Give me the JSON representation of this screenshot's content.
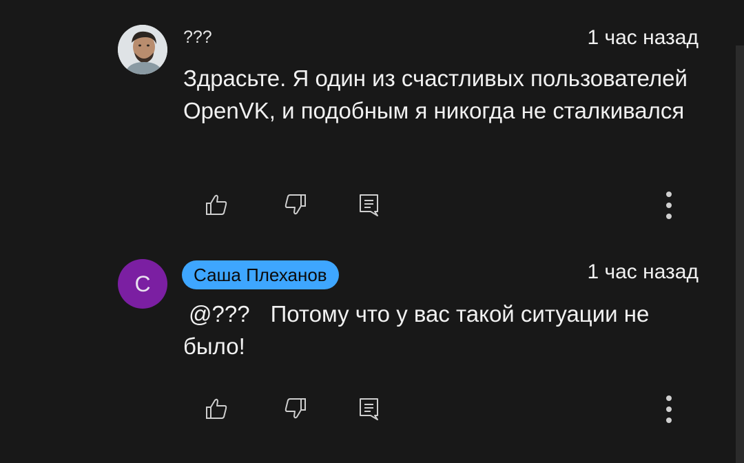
{
  "comments": [
    {
      "author": "???",
      "time": "1 час назад",
      "text": "Здрасьте. Я один из счастливых пользователей OpenVK, и подобным я никогда не сталкивался",
      "avatar_icon": "user-photo-avatar"
    },
    {
      "author": "Саша Плеханов",
      "author_chip_color": "#3ea6ff",
      "avatar_letter": "С",
      "avatar_color": "#7b1fa2",
      "time": "1 час назад",
      "mention": "@???",
      "text": "Потому что у вас такой ситуации не было!"
    }
  ],
  "actions": {
    "like_icon": "thumb-up-icon",
    "dislike_icon": "thumb-down-icon",
    "reply_icon": "reply-comment-icon",
    "more_icon": "more-vert-icon"
  },
  "colors": {
    "background": "#181818",
    "text": "#f1f1f1",
    "icon": "#cfcfcf"
  }
}
